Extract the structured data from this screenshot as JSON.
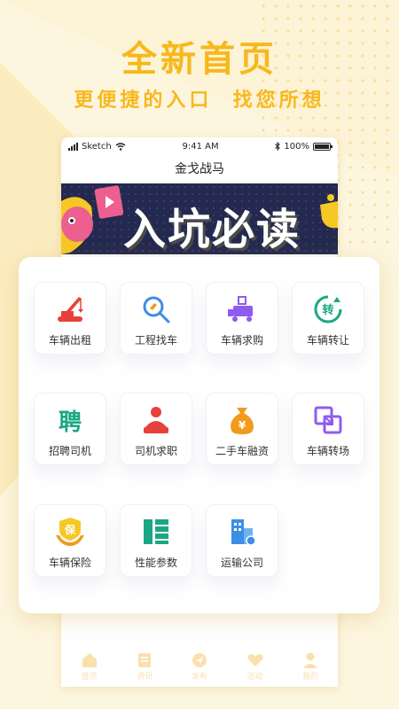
{
  "promo": {
    "headline": "全新首页",
    "subline": "更便捷的入口  找您所想"
  },
  "status_bar": {
    "carrier": "Sketch",
    "time": "9:41 AM",
    "battery": "100%"
  },
  "app": {
    "title": "金戈战马"
  },
  "banner": {
    "text": "入坑必读"
  },
  "grid": {
    "items": [
      {
        "label": "车辆出租",
        "icon": "crane-icon"
      },
      {
        "label": "工程找车",
        "icon": "magnifier-icon"
      },
      {
        "label": "车辆求购",
        "icon": "truck-icon"
      },
      {
        "label": "车辆转让",
        "icon": "transfer-icon"
      },
      {
        "label": "招聘司机",
        "icon": "recruit-icon"
      },
      {
        "label": "司机求职",
        "icon": "driver-icon"
      },
      {
        "label": "二手车融资",
        "icon": "money-bag-icon"
      },
      {
        "label": "车辆转场",
        "icon": "relocate-icon"
      },
      {
        "label": "车辆保险",
        "icon": "insurance-icon"
      },
      {
        "label": "性能参数",
        "icon": "parameters-icon"
      },
      {
        "label": "运输公司",
        "icon": "company-icon"
      }
    ]
  },
  "tabbar": {
    "items": [
      {
        "label": "首页",
        "icon": "home-icon"
      },
      {
        "label": "资讯",
        "icon": "news-icon"
      },
      {
        "label": "发布",
        "icon": "publish-icon"
      },
      {
        "label": "活动",
        "icon": "activity-icon"
      },
      {
        "label": "我的",
        "icon": "profile-icon"
      }
    ]
  },
  "colors": {
    "accent": "#f8b81c",
    "red": "#e8413b",
    "purple": "#8f5cf0",
    "green": "#1ba784",
    "blue": "#3b8fe6",
    "orange": "#f29a1c"
  }
}
